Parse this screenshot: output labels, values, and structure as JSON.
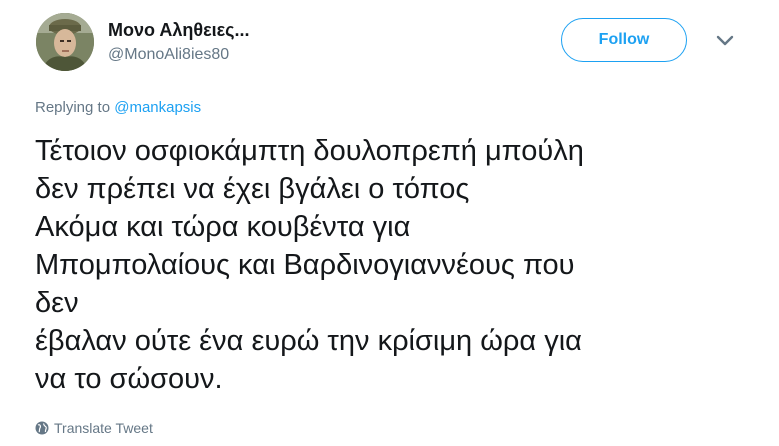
{
  "author": {
    "display_name": "Μονο Αληθειες...",
    "handle": "@MonoAli8ies80",
    "avatar_icon": "profile-photo"
  },
  "header": {
    "follow_label": "Follow",
    "menu_icon": "chevron-down-icon"
  },
  "reply": {
    "prefix": "Replying to",
    "target": "@mankapsis"
  },
  "tweet": {
    "lines": [
      "Τέτοιον οσφιοκάμπτη δουλοπρεπή μπούλη",
      "δεν πρέπει να έχει βγάλει ο τόπος",
      "Ακόμα και τώρα κουβέντα για",
      "Μπομπολαίους και Βαρδινογιαννέους που",
      "δεν",
      "έβαλαν ούτε ένα ευρώ την κρίσιμη ώρα για",
      "να το σώσουν."
    ]
  },
  "footer": {
    "translate_label": "Translate Tweet",
    "translate_icon": "globe-icon"
  },
  "colors": {
    "accent": "#1da1f2",
    "text": "#14171a",
    "muted": "#657786"
  }
}
